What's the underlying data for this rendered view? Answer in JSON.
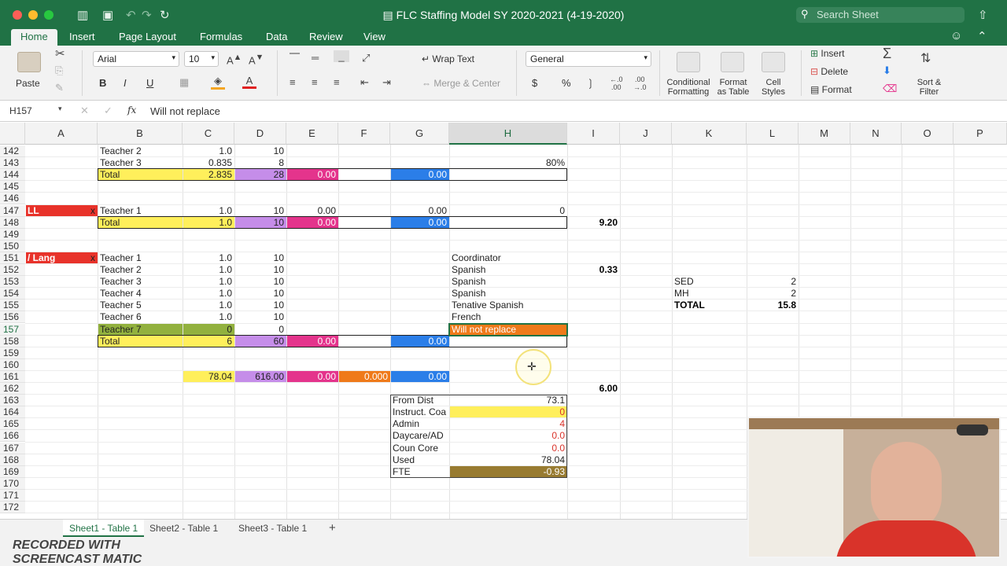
{
  "window": {
    "title": "FLC Staffing Model SY 2020-2021 (4-19-2020)",
    "search_placeholder": "Search Sheet"
  },
  "ribbon_tabs": [
    "Home",
    "Insert",
    "Page Layout",
    "Formulas",
    "Data",
    "Review",
    "View"
  ],
  "ribbon": {
    "paste": "Paste",
    "font_name": "Arial",
    "font_size": "10",
    "bold": "B",
    "italic": "I",
    "underline": "U",
    "wrap_text": "Wrap Text",
    "merge_center": "Merge & Center",
    "number_format": "General",
    "currency": "$",
    "percent": "%",
    "conditional_formatting": [
      "Conditional",
      "Formatting"
    ],
    "format_as_table": [
      "Format",
      "as Table"
    ],
    "cell_styles": [
      "Cell",
      "Styles"
    ],
    "insert": "Insert",
    "delete": "Delete",
    "format": "Format",
    "sort_filter": [
      "Sort &",
      "Filter"
    ]
  },
  "formula_bar": {
    "name_box": "H157",
    "fx": "fx",
    "content": "Will not replace"
  },
  "columns": [
    "A",
    "B",
    "C",
    "D",
    "E",
    "F",
    "G",
    "H",
    "I",
    "J",
    "K",
    "L",
    "M",
    "N",
    "O",
    "P"
  ],
  "selected_column": "H",
  "rows": [
    "142",
    "143",
    "144",
    "145",
    "146",
    "147",
    "148",
    "149",
    "150",
    "151",
    "152",
    "153",
    "154",
    "155",
    "156",
    "157",
    "158",
    "159",
    "160",
    "161",
    "162",
    "163",
    "164",
    "165",
    "166",
    "167",
    "168",
    "169",
    "170",
    "171",
    "172"
  ],
  "selected_row": "157",
  "cells": {
    "B142": "Teacher 2",
    "C142": "1.0",
    "D142": "10",
    "B143": "Teacher 3",
    "C143": "0.835",
    "D143": "8",
    "H143": "80%",
    "B144": "Total",
    "C144": "2.835",
    "D144": "28",
    "E144": "0.00",
    "G144": "0.00",
    "A147": "LL",
    "A147x": "x",
    "B147": "Teacher 1",
    "C147": "1.0",
    "D147": "10",
    "E147": "0.00",
    "G147": "0.00",
    "H147": "0",
    "B148": "Total",
    "C148": "1.0",
    "D148": "10",
    "E148": "0.00",
    "G148": "0.00",
    "I148": "9.20",
    "A151": "/ Lang",
    "A151x": "x",
    "B151": "Teacher 1",
    "C151": "1.0",
    "D151": "10",
    "H151": "Coordinator",
    "B152": "Teacher 2",
    "C152": "1.0",
    "D152": "10",
    "H152": "Spanish",
    "I152": "0.33",
    "B153": "Teacher 3",
    "C153": "1.0",
    "D153": "10",
    "H153": "Spanish",
    "K153": "SED",
    "L153": "2",
    "B154": "Teacher 4",
    "C154": "1.0",
    "D154": "10",
    "H154": "Spanish",
    "K154": "MH",
    "L154": "2",
    "B155": "Teacher 5",
    "C155": "1.0",
    "D155": "10",
    "H155": "Tenative Spanish",
    "K155": "TOTAL",
    "L155": "15.8",
    "B156": "Teacher 6",
    "C156": "1.0",
    "D156": "10",
    "H156": "French",
    "B157": "Teacher 7",
    "C157": "0",
    "D157": "0",
    "H157": "Will not replace",
    "B158": "Total",
    "C158": "6",
    "D158": "60",
    "E158": "0.00",
    "G158": "0.00",
    "C161": "78.04",
    "D161": "616.00",
    "E161": "0.00",
    "F161": "0.000",
    "G161": "0.00",
    "I162": "6.00",
    "G163": "From Dist",
    "H163": "73.1",
    "G164": "Instruct. Coa",
    "H164": "0",
    "G165": "Admin",
    "H165": "4",
    "G166": "Daycare/AD",
    "H166": "0.0",
    "G167": "Coun Core",
    "H167": "0.0",
    "G168": "Used",
    "H168": "78.04",
    "G169": "FTE",
    "H169": "-0.93"
  },
  "sheet_tabs": [
    "Sheet1 - Table 1",
    "Sheet2 - Table 1",
    "Sheet3 - Table 1"
  ],
  "add_sheet": "+",
  "watermark": "RECORDED WITH SCREENCAST MATIC"
}
